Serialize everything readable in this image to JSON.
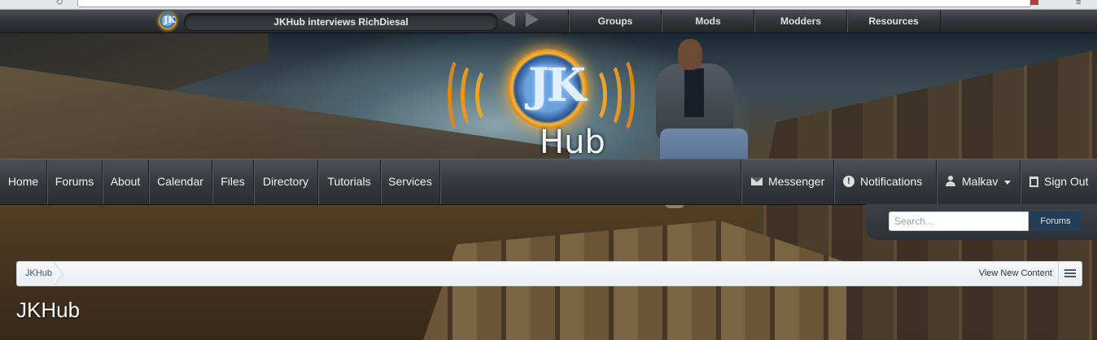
{
  "topbar": {
    "ticker_text": "JKHub interviews RichDiesal",
    "links": [
      "Groups",
      "Mods",
      "Modders",
      "Resources"
    ]
  },
  "logo": {
    "mini_letter": "JK",
    "letters": "JK",
    "hub": "Hub"
  },
  "nav": {
    "items": [
      "Home",
      "Forums",
      "About",
      "Calendar",
      "Files",
      "Directory",
      "Tutorials",
      "Services"
    ],
    "messenger": "Messenger",
    "notifications": "Notifications",
    "user": "Malkav",
    "signout": "Sign Out"
  },
  "search": {
    "placeholder": "Search...",
    "scope": "Forums"
  },
  "breadcrumb": {
    "home": "JKHub",
    "view_new": "View New Content"
  },
  "page_title": "JKHub"
}
